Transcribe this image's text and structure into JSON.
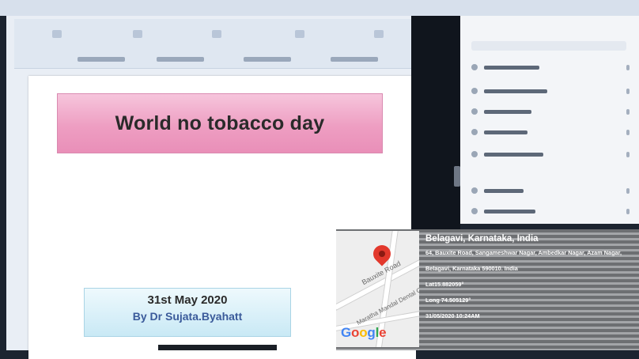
{
  "menubar": {
    "items": [
      "",
      "",
      "",
      "",
      "",
      ""
    ],
    "right_label": ""
  },
  "slide": {
    "title": "World no tobacco day",
    "date_line": "31st May 2020",
    "author_line": "By Dr Sujata.Byahatt"
  },
  "panel": {
    "title": "",
    "search_placeholder": ""
  },
  "geotag": {
    "city": "Belagavi, Karnataka, India",
    "address_line1": "64, Bauxite Road, Sangameshwar Nagar, Ambedkar Nagar, Azam Nagar,",
    "address_line2": "Belagavi, Karnataka 590010. India",
    "lat": "Lat15.882059°",
    "long": "Long 74.505129°",
    "datetime": "31/05/2020 10:24AM",
    "map_labels": {
      "road": "Bauxite Road",
      "college": "Maratha Mandal Dental College",
      "brand": "Google"
    }
  },
  "colors": {
    "title_box": "#ee9ec2",
    "date_box": "#c9e9f5",
    "pin": "#e2382c"
  }
}
